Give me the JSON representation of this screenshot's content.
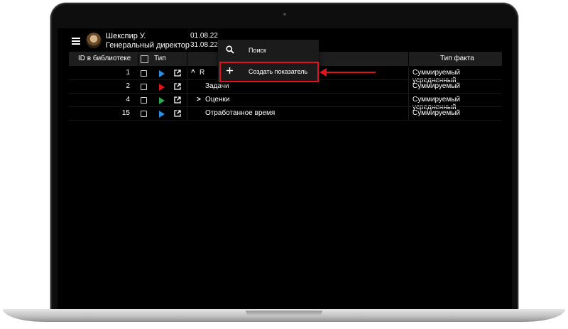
{
  "header": {
    "user_name": "Шекспир У.",
    "user_role": "Генеральный директор",
    "date_from": "01.08.22",
    "date_to": "31.08.22"
  },
  "table": {
    "columns": {
      "id": "ID в библиотеке",
      "type": "Тип",
      "fact_type": "Тип факта"
    },
    "rows": [
      {
        "id": "1",
        "type_color": "#2a8fe0",
        "expander": "^",
        "name": "R",
        "fact_type": "Суммируемый усредненный"
      },
      {
        "id": "2",
        "type_color": "#e0141c",
        "expander": "",
        "name": "Задачи",
        "fact_type": "Суммируемый"
      },
      {
        "id": "4",
        "type_color": "#2fa84f",
        "expander": ">",
        "name": "Оценки",
        "fact_type": "Суммируемый усредненный"
      },
      {
        "id": "15",
        "type_color": "#2a8fe0",
        "expander": "",
        "name": "Отработанное время",
        "fact_type": "Суммируемый"
      }
    ]
  },
  "popup": {
    "search_label": "Поиск",
    "create_label": "Создать показатель"
  },
  "colors": {
    "highlight": "#e0141c",
    "screen_bg": "#000000"
  },
  "icons": {
    "menu": "hamburger-icon",
    "search": "search-icon",
    "add": "plus-icon",
    "open": "open-in-new-icon"
  }
}
